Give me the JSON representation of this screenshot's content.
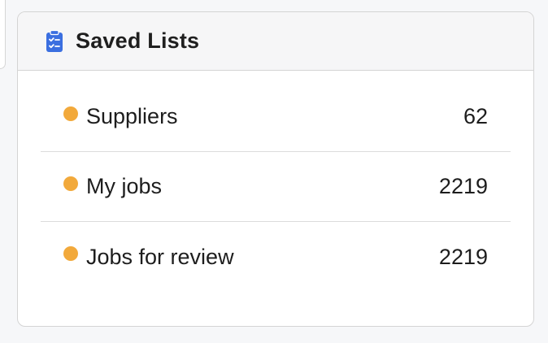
{
  "panel": {
    "title": "Saved Lists",
    "icon": "clipboard-checklist-icon",
    "icon_color": "#3b6fe0"
  },
  "lists": [
    {
      "label": "Suppliers",
      "count": "62",
      "status_color": "#f2a93b"
    },
    {
      "label": "My jobs",
      "count": "2219",
      "status_color": "#f2a93b"
    },
    {
      "label": "Jobs for review",
      "count": "2219",
      "status_color": "#f2a93b"
    }
  ]
}
